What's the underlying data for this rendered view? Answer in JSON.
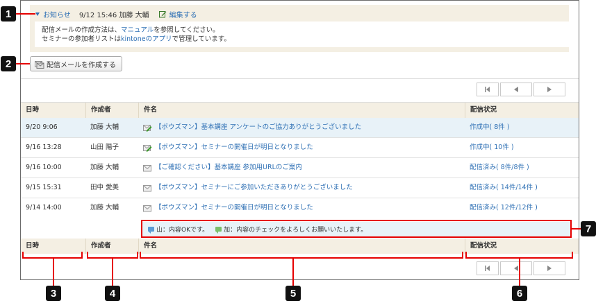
{
  "notice": {
    "toggle_label": "お知らせ",
    "meta": "9/12 15:46 加藤 大輔",
    "edit_label": "編集する",
    "line1_prefix": "配信メールの作成方法は、",
    "line1_link": "マニュアル",
    "line1_suffix": "を参照してください。",
    "line2_prefix": "セミナーの参加者リストは",
    "line2_link": "kintoneのアプリ",
    "line2_suffix": "で管理しています。"
  },
  "toolbar": {
    "create_label": "配信メールを作成する"
  },
  "table": {
    "headers": {
      "date": "日時",
      "author": "作成者",
      "subject": "件名",
      "status": "配信状況"
    },
    "rows": [
      {
        "date": "9/20 9:06",
        "author": "加藤 大輔",
        "subject": "【ボウズマン】基本講座 アンケートのご協力ありがとうございました",
        "status": "作成中( 8件 )",
        "icon": "mail-edit-icon"
      },
      {
        "date": "9/16 13:28",
        "author": "山田 陽子",
        "subject": "【ボウズマン】セミナーの開催日が明日となりました",
        "status": "作成中( 10件 )",
        "icon": "mail-edit-icon"
      },
      {
        "date": "9/16 10:00",
        "author": "加藤 大輔",
        "subject": "【ご確認ください】基本講座 参加用URLのご案内",
        "status": "配信済み( 8件/8件 )",
        "icon": "mail-sent-icon"
      },
      {
        "date": "9/15 15:31",
        "author": "田中 愛美",
        "subject": "【ボウズマン】セミナーにご参加いただきありがとうございました",
        "status": "配信済み( 14件/14件 )",
        "icon": "mail-sent-icon"
      },
      {
        "date": "9/14 14:00",
        "author": "加藤 大輔",
        "subject": "【ボウズマン】セミナーの開催日が明日となりました",
        "status": "配信済み( 12件/12件 )",
        "icon": "mail-sent-icon"
      }
    ],
    "comments": {
      "c1": "山：内容OKです。",
      "c2": "加：内容のチェックをよろしくお願いいたします。"
    }
  },
  "callouts": [
    "1",
    "2",
    "3",
    "4",
    "5",
    "6",
    "7"
  ],
  "colors": {
    "accent": "#2d6fb4",
    "callout": "#e60000",
    "header_bg": "#f4efe3",
    "selected_row": "#e8f2f8"
  }
}
